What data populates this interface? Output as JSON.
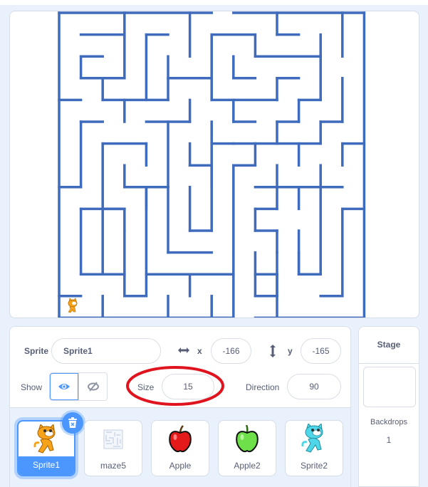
{
  "stage": {
    "backdrop_name": "maze5",
    "wall_color": "#3f6bbd",
    "cursor_sprite": "cat-sprite"
  },
  "sprite_info": {
    "sprite_label": "Sprite",
    "sprite_name": "Sprite1",
    "x_label": "x",
    "x_value": "-166",
    "y_label": "y",
    "y_value": "-165",
    "show_label": "Show",
    "show_visible": true,
    "size_label": "Size",
    "size_value": "15",
    "direction_label": "Direction",
    "direction_value": "90"
  },
  "sprites": [
    {
      "name": "Sprite1",
      "icon": "orange-cat-icon",
      "selected": true
    },
    {
      "name": "maze5",
      "icon": "maze-thumbnail-icon",
      "selected": false
    },
    {
      "name": "Apple",
      "icon": "red-apple-icon",
      "selected": false
    },
    {
      "name": "Apple2",
      "icon": "green-apple-icon",
      "selected": false
    },
    {
      "name": "Sprite2",
      "icon": "blue-cat-icon",
      "selected": false
    }
  ],
  "stage_panel": {
    "title": "Stage",
    "backdrops_label": "Backdrops",
    "backdrops_count": "1"
  },
  "colors": {
    "accent": "#4c97ff",
    "annotation": "#e0141e",
    "text": "#575e75"
  }
}
